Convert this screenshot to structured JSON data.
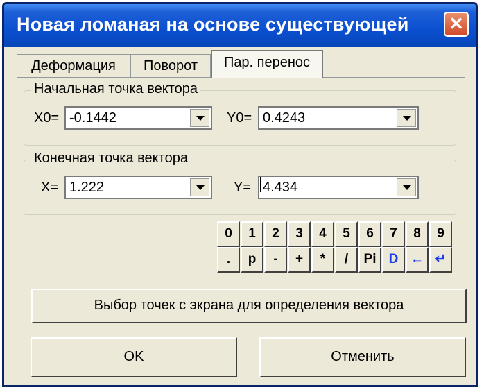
{
  "window": {
    "title": "Новая ломаная на основе существующей",
    "close_glyph": "✕"
  },
  "tabs": [
    {
      "label": "Деформация",
      "active": false
    },
    {
      "label": "Поворот",
      "active": false
    },
    {
      "label": "Пар. перенос",
      "active": true
    }
  ],
  "start_group": {
    "label": "Начальная точка вектора",
    "x_label": "X0=",
    "x_value": "-0.1442",
    "y_label": "Y0=",
    "y_value": "0.4243"
  },
  "end_group": {
    "label": "Конечная точка вектора",
    "x_label": "X=",
    "x_value": "1.222",
    "y_label": "Y=",
    "y_value": "4.434"
  },
  "keypad": {
    "row1": [
      "0",
      "1",
      "2",
      "3",
      "4",
      "5",
      "6",
      "7",
      "8",
      "9"
    ],
    "row2": [
      ".",
      "p",
      "-",
      "+",
      "*",
      "/",
      "Pi",
      "D",
      "←",
      "↵"
    ]
  },
  "pick_button": "Выбор точек с экрана для определения вектора",
  "ok_button": "OK",
  "cancel_button": "Отменить"
}
